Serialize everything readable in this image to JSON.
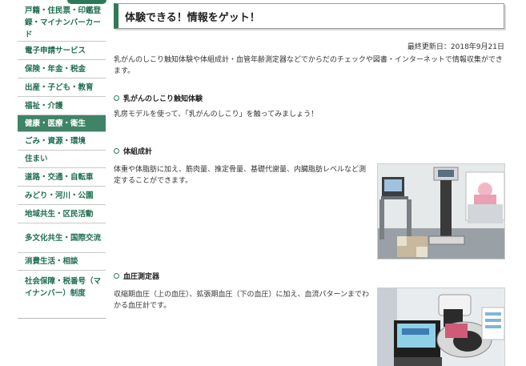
{
  "sidebar": {
    "items": [
      {
        "label": "戸籍・住民票・印鑑登録・マイナンバーカード",
        "active": false
      },
      {
        "label": "電子申請サービス",
        "active": false
      },
      {
        "label": "保険・年金・税金",
        "active": false
      },
      {
        "label": "出産・子ども・教育",
        "active": false
      },
      {
        "label": "福祉・介護",
        "active": false
      },
      {
        "label": "健康・医療・衛生",
        "active": true
      },
      {
        "label": "ごみ・資源・環境",
        "active": false
      },
      {
        "label": "住まい",
        "active": false
      },
      {
        "label": "道路・交通・自転車",
        "active": false
      },
      {
        "label": "みどり・河川・公園",
        "active": false
      },
      {
        "label": "地域共生・区民活動",
        "active": false
      },
      {
        "label": "多文化共生・国際交流",
        "active": false
      },
      {
        "label": "消費生活・相談",
        "active": false
      },
      {
        "label": "社会保障・税番号（マイナンバー）制度",
        "active": false
      }
    ]
  },
  "main": {
    "title": "体験できる！情報をゲット！",
    "updated": "最終更新日：2018年9月21日",
    "intro": "乳がんのしこり触知体験や体組成計・血管年齢測定器などでからだのチェックや図書・インターネットで情報収集ができます。",
    "sections": [
      {
        "heading": "乳がんのしこり触知体験",
        "text": "乳房モデルを使って、「乳がんのしこり」を触ってみましょう！"
      },
      {
        "heading": "体組成計",
        "text": "体重や体脂肪に加え、筋肉量、推定骨量、基礎代謝量、内臓脂肪レベルなど測定することができます。"
      },
      {
        "heading": "血圧測定器",
        "text": "収縮期血圧（上の血圧）、拡張期血圧（下の血圧）に加え、血流パターンまでわかる血圧計です。"
      }
    ]
  },
  "colors": {
    "accent": "#2f7a58",
    "nav_text": "#1e6e50",
    "active_bg": "#3f8466"
  }
}
